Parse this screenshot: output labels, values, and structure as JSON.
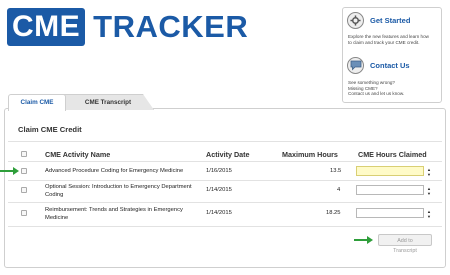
{
  "logo": {
    "box_text": "CME",
    "text": "TRACKER"
  },
  "side_panel": {
    "get_started": {
      "title": "Get Started",
      "lines": [
        "Explore the new features and learn how",
        "to claim and track your CME credit."
      ]
    },
    "contact": {
      "title": "Contact Us",
      "lines": [
        "See something wrong?",
        "Missing CME?",
        "Contact us and let us know."
      ]
    }
  },
  "tabs": [
    {
      "label": "Claim CME",
      "active": true
    },
    {
      "label": "CME Transcript",
      "active": false
    }
  ],
  "section_title": "Claim CME Credit",
  "table": {
    "headers": {
      "name": "CME Activity Name",
      "date": "Activity Date",
      "max": "Maximum Hours",
      "claimed": "CME Hours Claimed"
    },
    "rows": [
      {
        "name_lines": [
          "Advanced Procedure Coding for Emergency Medicine"
        ],
        "date": "1/16/2015",
        "max": "13.5",
        "claimed": "",
        "highlighted": true
      },
      {
        "name_lines": [
          "Optional Session: Introduction to Emergency Department",
          "Coding"
        ],
        "date": "1/14/2015",
        "max": "4",
        "claimed": "",
        "highlighted": false
      },
      {
        "name_lines": [
          "Reimbursement: Trends and Strategies in Emergency",
          "Medicine"
        ],
        "date": "1/14/2015",
        "max": "18.25",
        "claimed": "",
        "highlighted": false
      }
    ]
  },
  "add_button": {
    "label": "Add to Transcript"
  },
  "colors": {
    "brand": "#1b5aa6",
    "arrow": "#2e9e3a",
    "highlight": "#fffbc8"
  },
  "icons": {
    "get_started": "gear-icon",
    "contact": "speech-bubble-icon",
    "arrow": "green-arrow-icon"
  }
}
